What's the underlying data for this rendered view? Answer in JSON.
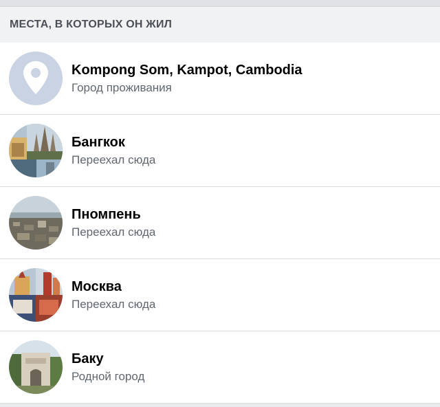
{
  "section": {
    "title": "МЕСТА, В КОТОРЫХ ОН ЖИЛ"
  },
  "places": [
    {
      "icon": "location-pin-icon",
      "title": "Kompong Som, Kampot, Cambodia",
      "subtitle": "Город проживания"
    },
    {
      "icon": "bangkok-photo",
      "title": "Бангкок",
      "subtitle": "Переехал сюда"
    },
    {
      "icon": "phnompenh-photo",
      "title": "Пномпень",
      "subtitle": "Переехал сюда"
    },
    {
      "icon": "moscow-photo",
      "title": "Москва",
      "subtitle": "Переехал сюда"
    },
    {
      "icon": "baku-photo",
      "title": "Баку",
      "subtitle": "Родной город"
    }
  ],
  "colors": {
    "pin_bg": "#c9d3e4",
    "header_bg": "#f1f2f4",
    "header_text": "#4b4f56",
    "subtitle": "#606770"
  }
}
